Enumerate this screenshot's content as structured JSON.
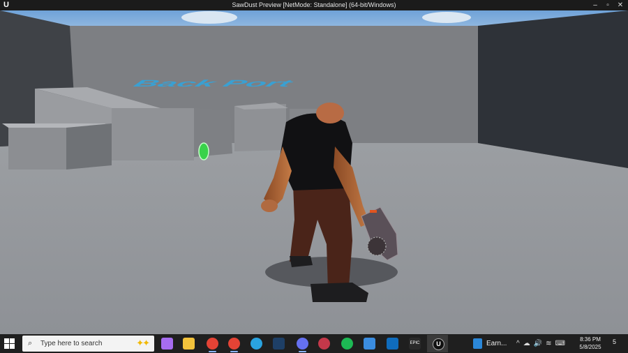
{
  "window": {
    "title": "SawDust Preview [NetMode: Standalone] (64-bit/Windows)",
    "logo_icon": "unreal-logo-icon",
    "logo_text": "U",
    "controls": {
      "minimize": "–",
      "restore": "▫",
      "close": "✕"
    }
  },
  "viewport": {
    "floor_text": "Back Port"
  },
  "taskbar": {
    "start_icon": "windows-start-icon",
    "search_placeholder": "Type here to search",
    "search_icon": "⌕",
    "copilot_icon": "✦✦",
    "pinned": [
      {
        "name": "copilot-app-icon",
        "color": "#a66cf0"
      },
      {
        "name": "file-explorer-icon",
        "color": "#f2c23c"
      },
      {
        "name": "chrome-icon",
        "color": "#e44335"
      },
      {
        "name": "chrome-profile-icon",
        "color": "#e44335"
      },
      {
        "name": "edge-icon",
        "color": "#2aa3e0"
      },
      {
        "name": "steam-icon",
        "color": "#1e3f66"
      },
      {
        "name": "discord-icon",
        "color": "#6570f0"
      },
      {
        "name": "speedometer-icon",
        "color": "#c4384a"
      },
      {
        "name": "spotify-icon",
        "color": "#1db954"
      },
      {
        "name": "microsoft-store-icon",
        "color": "#3b8de0"
      },
      {
        "name": "outlook-icon",
        "color": "#0f6cbd"
      },
      {
        "name": "epic-games-icon",
        "color": "#2a2a2a"
      }
    ],
    "epic_label": "EPIC",
    "ue_task_label": "U",
    "earnings_label": "Earn...",
    "tray": {
      "chevron": "^",
      "cloud": "☁",
      "volume": "🔊",
      "wifi": "≋",
      "keyboard": "⌨"
    },
    "time": "8:36 PM",
    "date": "5/8/2025",
    "notification_count": "5"
  }
}
